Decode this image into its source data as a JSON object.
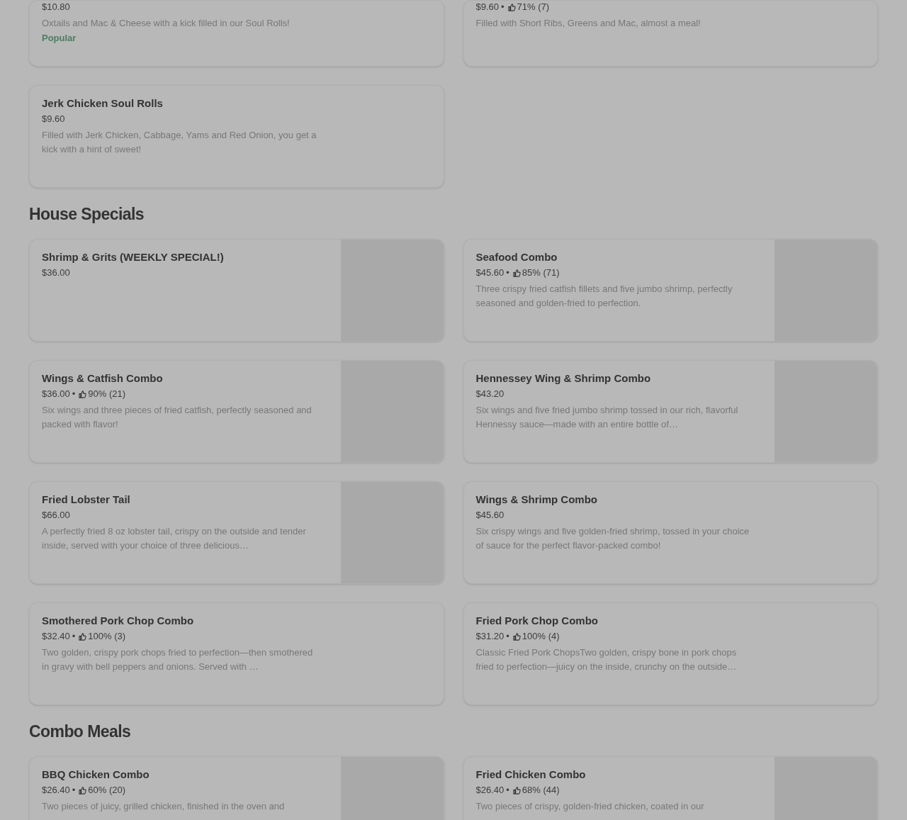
{
  "sections": [
    {
      "items": [
        {
          "price": "$10.80",
          "description": "Oxtails and Mac & Cheese with a kick filled in our Soul Rolls!",
          "badge": "Popular",
          "has_image": false
        },
        {
          "price": "$9.60",
          "separator": "•",
          "rating": "71% (7)",
          "description": "Filled with Short Ribs, Greens and Mac, almost a meal!",
          "has_image": false
        },
        {
          "name": "Jerk Chicken Soul Rolls",
          "price": "$9.60",
          "description": "Filled with Jerk Chicken, Cabbage, Yams and Red Onion, you get a kick with a hint of sweet!",
          "has_image": false
        }
      ]
    },
    {
      "title": "House Specials",
      "items": [
        {
          "name": "Shrimp & Grits (WEEKLY SPECIAL!)",
          "price": "$36.00",
          "has_image": true
        },
        {
          "name": "Seafood Combo",
          "price": "$45.60",
          "separator": "•",
          "rating": "85% (71)",
          "description": "Three crispy fried catfish fillets and five jumbo shrimp, perfectly seasoned and golden-fried to perfection.",
          "has_image": true
        },
        {
          "name": "Wings & Catfish Combo",
          "price": "$36.00",
          "separator": "•",
          "rating": "90% (21)",
          "description": "Six wings and three pieces of fried catfish, perfectly seasoned and packed with flavor!",
          "has_image": true
        },
        {
          "name": "Hennessey Wing & Shrimp Combo",
          "price": "$43.20",
          "description": "Six wings and five fried jumbo shrimp tossed in our rich, flavorful Hennessy sauce—made with an entire bottle of…",
          "has_image": true
        },
        {
          "name": "Fried Lobster Tail",
          "price": "$66.00",
          "description": "A perfectly fried 8 oz lobster tail, crispy on the outside and tender inside, served with your choice of three delicious…",
          "has_image": true
        },
        {
          "name": "Wings & Shrimp Combo",
          "price": "$45.60",
          "description": "Six crispy wings and five golden-fried shrimp, tossed in your choice of sauce for the perfect flavor-packed combo!",
          "has_image": false
        },
        {
          "name": "Smothered Pork Chop Combo",
          "price": "$32.40",
          "separator": "•",
          "rating": "100% (3)",
          "description": "Two golden, crispy pork chops fried to perfection—then smothered in gravy with bell peppers and onions. Served with …",
          "has_image": false
        },
        {
          "name": "Fried Pork Chop Combo",
          "price": "$31.20",
          "separator": "•",
          "rating": "100% (4)",
          "description": "Classic Fried Pork ChopsTwo golden, crispy bone in pork chops fried to perfection—juicy on the inside, crunchy on the outside…",
          "has_image": false
        }
      ]
    },
    {
      "title": "Combo Meals",
      "items": [
        {
          "name": "BBQ Chicken Combo",
          "price": "$26.40",
          "separator": "•",
          "rating": "60% (20)",
          "description": "Two pieces of juicy, grilled chicken, finished in the oven and",
          "has_image": true
        },
        {
          "name": "Fried Chicken Combo",
          "price": "$26.40",
          "separator": "•",
          "rating": "68% (44)",
          "description": "Two pieces of crispy, golden-fried chicken, coated in our",
          "has_image": true
        }
      ]
    }
  ]
}
